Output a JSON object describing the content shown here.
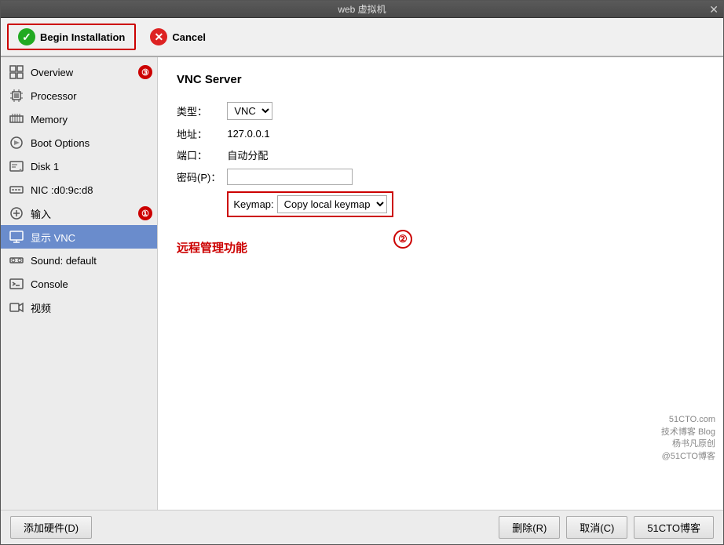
{
  "window": {
    "title": "web 虚拟机"
  },
  "toolbar": {
    "begin_label": "Begin Installation",
    "cancel_label": "Cancel"
  },
  "sidebar": {
    "items": [
      {
        "id": "overview",
        "label": "Overview",
        "badge": "③"
      },
      {
        "id": "processor",
        "label": "Processor",
        "badge": ""
      },
      {
        "id": "memory",
        "label": "Memory",
        "badge": ""
      },
      {
        "id": "boot-options",
        "label": "Boot Options",
        "badge": ""
      },
      {
        "id": "disk1",
        "label": "Disk 1",
        "badge": ""
      },
      {
        "id": "nic",
        "label": "NIC :d0:9c:d8",
        "badge": ""
      },
      {
        "id": "input",
        "label": "输入",
        "badge": "①"
      },
      {
        "id": "display-vnc",
        "label": "显示 VNC",
        "badge": "",
        "active": true
      },
      {
        "id": "sound",
        "label": "Sound: default",
        "badge": ""
      },
      {
        "id": "console",
        "label": "Console",
        "badge": ""
      },
      {
        "id": "video",
        "label": "视频",
        "badge": ""
      }
    ]
  },
  "content": {
    "section_title": "VNC Server",
    "type_label": "类型：",
    "type_value": "VNC",
    "address_label": "地址：",
    "address_value": "127.0.0.1",
    "port_label": "端口：",
    "port_value": "自动分配",
    "password_label": "密码(P)：",
    "password_value": "",
    "keymap_label": "Keymap:",
    "keymap_value": "Copy local keymap",
    "badge2": "②",
    "remote_label": "远程管理功能"
  },
  "footer": {
    "add_hardware_label": "添加硬件(D)",
    "delete_label": "删除(R)",
    "cancel_label": "取消(C)",
    "apply_label": "51CTO博客"
  }
}
